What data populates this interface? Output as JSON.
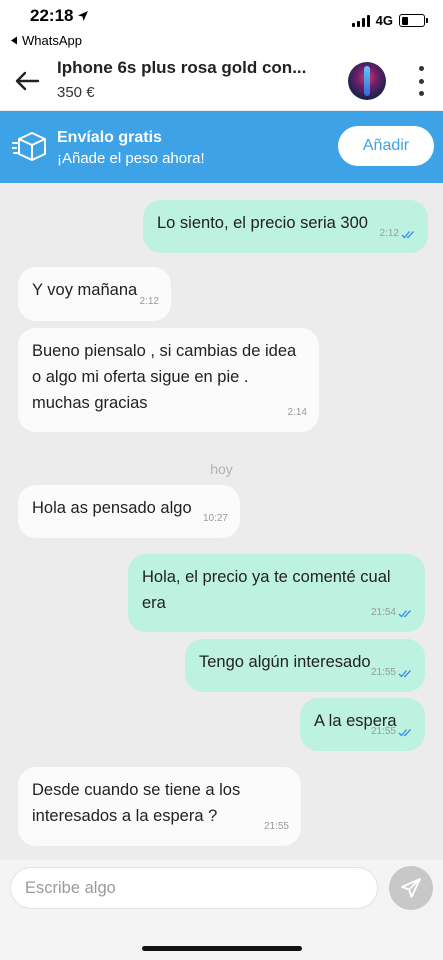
{
  "status_bar": {
    "time": "22:18",
    "back_app": "WhatsApp",
    "network": "4G",
    "battery_level": 0.3
  },
  "header": {
    "title": "Iphone 6s plus rosa gold con...",
    "price": "350 €"
  },
  "banner": {
    "title": "Envíalo gratis",
    "subtitle": "¡Añade el peso ahora!",
    "button": "Añadir"
  },
  "day_separator": "hoy",
  "messages": [
    {
      "dir": "out",
      "text": "Lo siento, el precio seria 300",
      "time": "2:12",
      "read": true
    },
    {
      "dir": "in",
      "text": "Y voy mañana",
      "time": "2:12"
    },
    {
      "dir": "in",
      "text": "Bueno piensalo , si cambias de idea o algo mi oferta sigue en pie . muchas gracias",
      "time": "2:14"
    },
    {
      "dir": "in",
      "text": "Hola as pensado algo",
      "time": "10:27"
    },
    {
      "dir": "out",
      "text": "Hola, el precio ya te comenté cual era",
      "time": "21:54",
      "read": true
    },
    {
      "dir": "out",
      "text": "Tengo algún interesado",
      "time": "21:55",
      "read": true
    },
    {
      "dir": "out",
      "text": "A la espera",
      "time": "21:55",
      "read": true
    },
    {
      "dir": "in",
      "text": "Desde cuando se tiene a los interesados a la espera ?",
      "time": "21:55"
    }
  ],
  "composer": {
    "placeholder": "Escribe algo"
  },
  "colors": {
    "banner": "#3ea3e6",
    "outgoing": "#bdf1e0",
    "incoming": "#fbfbfb",
    "ticks": "#3a8fe0"
  }
}
